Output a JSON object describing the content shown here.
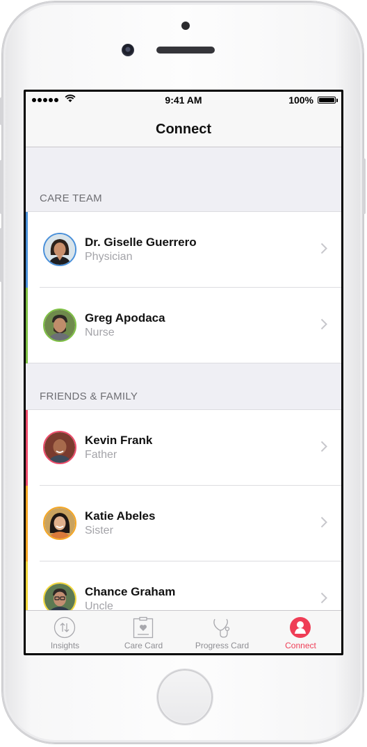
{
  "status_bar": {
    "time": "9:41 AM",
    "battery": "100%"
  },
  "nav": {
    "title": "Connect"
  },
  "sections": [
    {
      "header": "CARE TEAM",
      "contacts": [
        {
          "name": "Dr. Giselle Guerrero",
          "role": "Physician",
          "color": "#4a90d9"
        },
        {
          "name": "Greg Apodaca",
          "role": "Nurse",
          "color": "#7ec043"
        }
      ]
    },
    {
      "header": "FRIENDS & FAMILY",
      "contacts": [
        {
          "name": "Kevin Frank",
          "role": "Father",
          "color": "#ec4a6a"
        },
        {
          "name": "Katie Abeles",
          "role": "Sister",
          "color": "#f5a623"
        },
        {
          "name": "Chance Graham",
          "role": "Uncle",
          "color": "#f2d73b"
        }
      ]
    }
  ],
  "tabs": [
    {
      "label": "Insights",
      "icon": "insights-icon"
    },
    {
      "label": "Care Card",
      "icon": "care-card-icon"
    },
    {
      "label": "Progress Card",
      "icon": "progress-card-icon"
    },
    {
      "label": "Connect",
      "icon": "connect-icon",
      "active": true
    }
  ],
  "colors": {
    "accent": "#ef3d56",
    "separator": "#dcdce0"
  }
}
